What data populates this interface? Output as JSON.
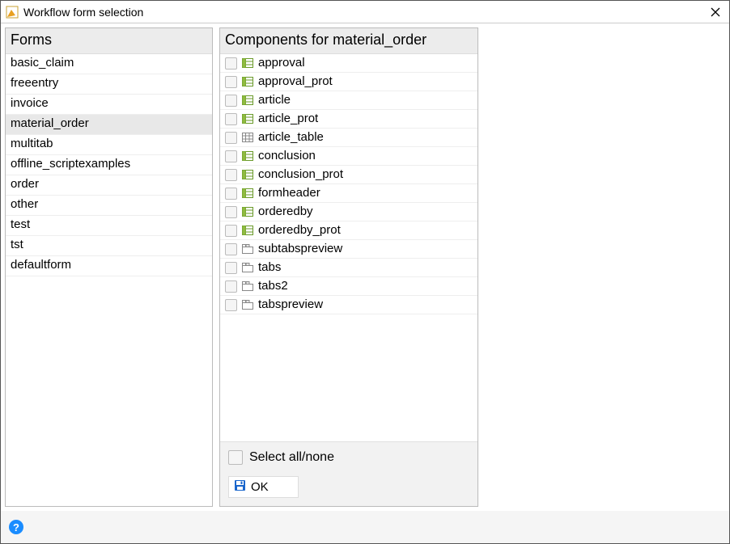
{
  "window": {
    "title": "Workflow form selection"
  },
  "formsPanel": {
    "header": "Forms",
    "items": [
      {
        "label": "basic_claim",
        "selected": false
      },
      {
        "label": "freeentry",
        "selected": false
      },
      {
        "label": "invoice",
        "selected": false
      },
      {
        "label": "material_order",
        "selected": true
      },
      {
        "label": "multitab",
        "selected": false
      },
      {
        "label": "offline_scriptexamples",
        "selected": false
      },
      {
        "label": "order",
        "selected": false
      },
      {
        "label": "other",
        "selected": false
      },
      {
        "label": "test",
        "selected": false
      },
      {
        "label": "tst",
        "selected": false
      },
      {
        "label": "defaultform",
        "selected": false
      }
    ]
  },
  "componentsPanel": {
    "header": "Components for material_order",
    "items": [
      {
        "label": "approval",
        "icon": "form",
        "checked": false
      },
      {
        "label": "approval_prot",
        "icon": "form",
        "checked": false
      },
      {
        "label": "article",
        "icon": "form",
        "checked": false
      },
      {
        "label": "article_prot",
        "icon": "form",
        "checked": false
      },
      {
        "label": "article_table",
        "icon": "table",
        "checked": false
      },
      {
        "label": "conclusion",
        "icon": "form",
        "checked": false
      },
      {
        "label": "conclusion_prot",
        "icon": "form",
        "checked": false
      },
      {
        "label": "formheader",
        "icon": "form",
        "checked": false
      },
      {
        "label": "orderedby",
        "icon": "form",
        "checked": false
      },
      {
        "label": "orderedby_prot",
        "icon": "form",
        "checked": false
      },
      {
        "label": "subtabspreview",
        "icon": "tabs",
        "checked": false
      },
      {
        "label": "tabs",
        "icon": "tabs",
        "checked": false
      },
      {
        "label": "tabs2",
        "icon": "tabs",
        "checked": false
      },
      {
        "label": "tabspreview",
        "icon": "tabs",
        "checked": false
      }
    ],
    "selectAllLabel": "Select all/none",
    "okLabel": "OK"
  }
}
